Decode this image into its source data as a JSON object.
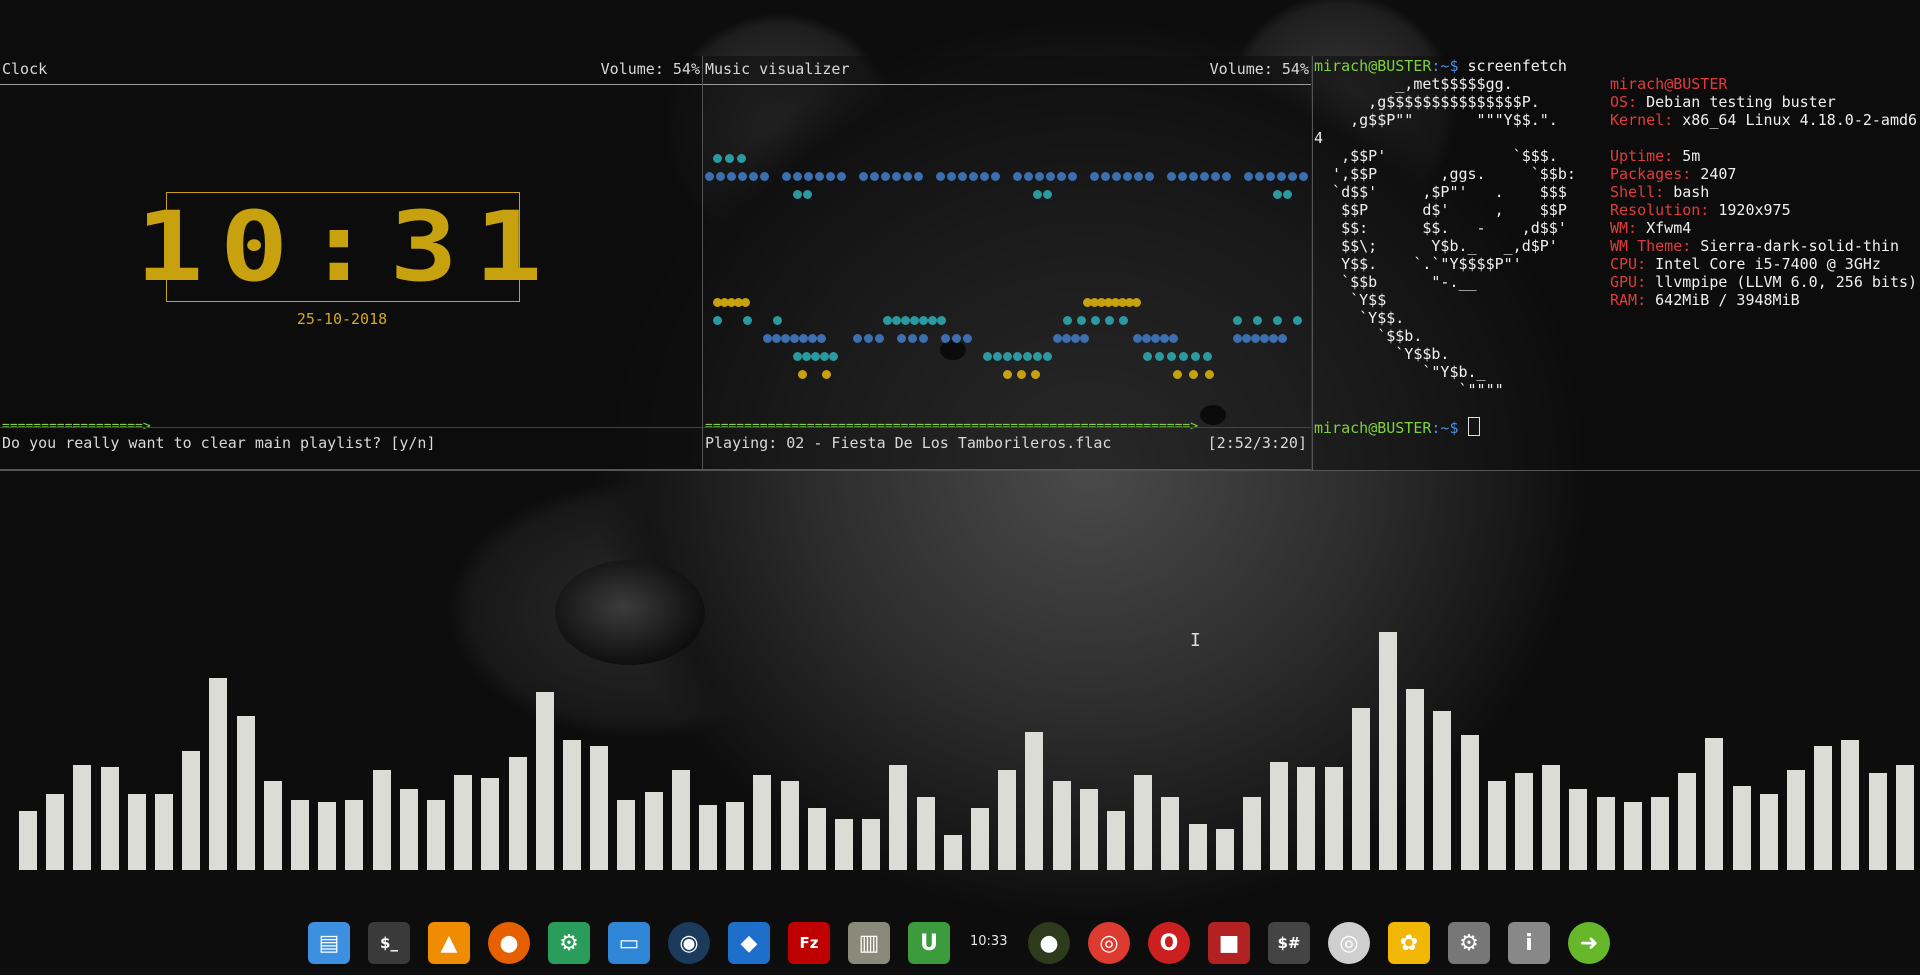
{
  "colors": {
    "accent_gold": "#c7a20e",
    "prompt_green": "#7fd23c",
    "prompt_blue": "#4a90e2",
    "label_red": "#e23b3b",
    "bar_white": "#dcdcd6"
  },
  "clock_pane": {
    "title": "Clock",
    "volume": "Volume: 54%",
    "time": "10:31",
    "date": "25-10-2018",
    "progress": "==================>",
    "prompt": "Do you really want to clear main playlist? [y/n]"
  },
  "visualizer_pane": {
    "title": "Music visualizer",
    "volume": "Volume: 54%",
    "progress": "==============================================================>",
    "now_playing": "Playing: 02 - Fiesta De Los Tamborileros.flac",
    "elapsed": "[2:52/3:20]"
  },
  "screenfetch": {
    "user": "mirach",
    "host": "BUSTER",
    "prompt_path": ":~$",
    "command": "screenfetch",
    "logo": [
      "         _,met$$$$$gg.",
      "      ,g$$$$$$$$$$$$$$$P.",
      "    ,g$$P\"\"       \"\"\"Y$$.\".",
      "4",
      "   ,$$P'              `$$$.",
      "  ',$$P       ,ggs.     `$$b:",
      "  `d$$'     ,$P\"'   .    $$$",
      "   $$P      d$'     ,    $$P",
      "   $$:      $$.   -    ,d$$'",
      "   $$\\;      Y$b._   _,d$P'",
      "   Y$$.    `.`\"Y$$$$P\"'",
      "   `$$b      \"-.__",
      "    `Y$$",
      "     `Y$$.",
      "       `$$b.",
      "         `Y$$b.",
      "            `\"Y$b._",
      "                `\"\"\"\""
    ],
    "info": [
      {
        "label": "OS:",
        "value": "Debian testing buster"
      },
      {
        "label": "Kernel:",
        "value": "x86_64 Linux 4.18.0-2-amd6"
      },
      {
        "label": "",
        "value": ""
      },
      {
        "label": "Uptime:",
        "value": "5m"
      },
      {
        "label": "Packages:",
        "value": "2407"
      },
      {
        "label": "Shell:",
        "value": "bash"
      },
      {
        "label": "Resolution:",
        "value": "1920x975"
      },
      {
        "label": "WM:",
        "value": "Xfwm4"
      },
      {
        "label": "WM Theme:",
        "value": "Sierra-dark-solid-thin"
      },
      {
        "label": "CPU:",
        "value": "Intel Core i5-7400 @ 3GHz"
      },
      {
        "label": "GPU:",
        "value": "llvmpipe (LLVM 6.0, 256 bits)"
      },
      {
        "label": "RAM:",
        "value": "642MiB / 3948MiB"
      }
    ]
  },
  "spectrum": {
    "levels": [
      0.22,
      0.28,
      0.39,
      0.38,
      0.28,
      0.28,
      0.44,
      0.71,
      0.57,
      0.33,
      0.26,
      0.25,
      0.26,
      0.37,
      0.3,
      0.26,
      0.35,
      0.34,
      0.42,
      0.66,
      0.48,
      0.46,
      0.26,
      0.29,
      0.37,
      0.24,
      0.25,
      0.35,
      0.33,
      0.23,
      0.19,
      0.19,
      0.39,
      0.27,
      0.13,
      0.23,
      0.37,
      0.51,
      0.33,
      0.3,
      0.22,
      0.35,
      0.27,
      0.17,
      0.15,
      0.27,
      0.4,
      0.38,
      0.38,
      0.6,
      0.88,
      0.67,
      0.59,
      0.5,
      0.33,
      0.36,
      0.39,
      0.3,
      0.27,
      0.25,
      0.27,
      0.36,
      0.49,
      0.31,
      0.28,
      0.37,
      0.46,
      0.48,
      0.36,
      0.39
    ]
  },
  "dock": {
    "clock": "10:33",
    "icons": [
      {
        "name": "file-manager-icon",
        "glyph": "▤",
        "color": "#3d8fe0"
      },
      {
        "name": "terminal-icon",
        "glyph": "$_",
        "color": "#3a3a3a"
      },
      {
        "name": "vlc-icon",
        "glyph": "▲",
        "color": "#f08c00"
      },
      {
        "name": "firefox-icon",
        "glyph": "●",
        "color": "#e66000"
      },
      {
        "name": "settings-gear-icon",
        "glyph": "⚙",
        "color": "#2a9d5c"
      },
      {
        "name": "desktop-icon",
        "glyph": "▭",
        "color": "#2f86d6"
      },
      {
        "name": "steam-icon",
        "glyph": "◉",
        "color": "#1b3a5c"
      },
      {
        "name": "water-drop-icon",
        "glyph": "◆",
        "color": "#1e6fc9"
      },
      {
        "name": "filezilla-icon",
        "glyph": "Fz",
        "color": "#bf0000"
      },
      {
        "name": "archive-manager-icon",
        "glyph": "▥",
        "color": "#8a8a7a"
      },
      {
        "name": "upwork-icon",
        "glyph": "U",
        "color": "#3c9b3c"
      },
      {
        "name": "music-player-icon",
        "glyph": "●",
        "color": "#2d3b1c"
      },
      {
        "name": "chrome-icon",
        "glyph": "◎",
        "color": "#dd3b2f"
      },
      {
        "name": "opera-icon",
        "glyph": "O",
        "color": "#cc1f1f"
      },
      {
        "name": "screen-recorder-icon",
        "glyph": "■",
        "color": "#b22222"
      },
      {
        "name": "root-terminal-icon",
        "glyph": "$#",
        "color": "#444"
      },
      {
        "name": "disc-burner-icon",
        "glyph": "◎",
        "color": "#cfcfcf"
      },
      {
        "name": "photos-pinwheel-icon",
        "glyph": "✿",
        "color": "#f2b705"
      },
      {
        "name": "disk-settings-icon",
        "glyph": "⚙",
        "color": "#777"
      },
      {
        "name": "system-info-icon",
        "glyph": "i",
        "color": "#888"
      },
      {
        "name": "update-arrow-icon",
        "glyph": "➜",
        "color": "#66b82a"
      }
    ]
  }
}
